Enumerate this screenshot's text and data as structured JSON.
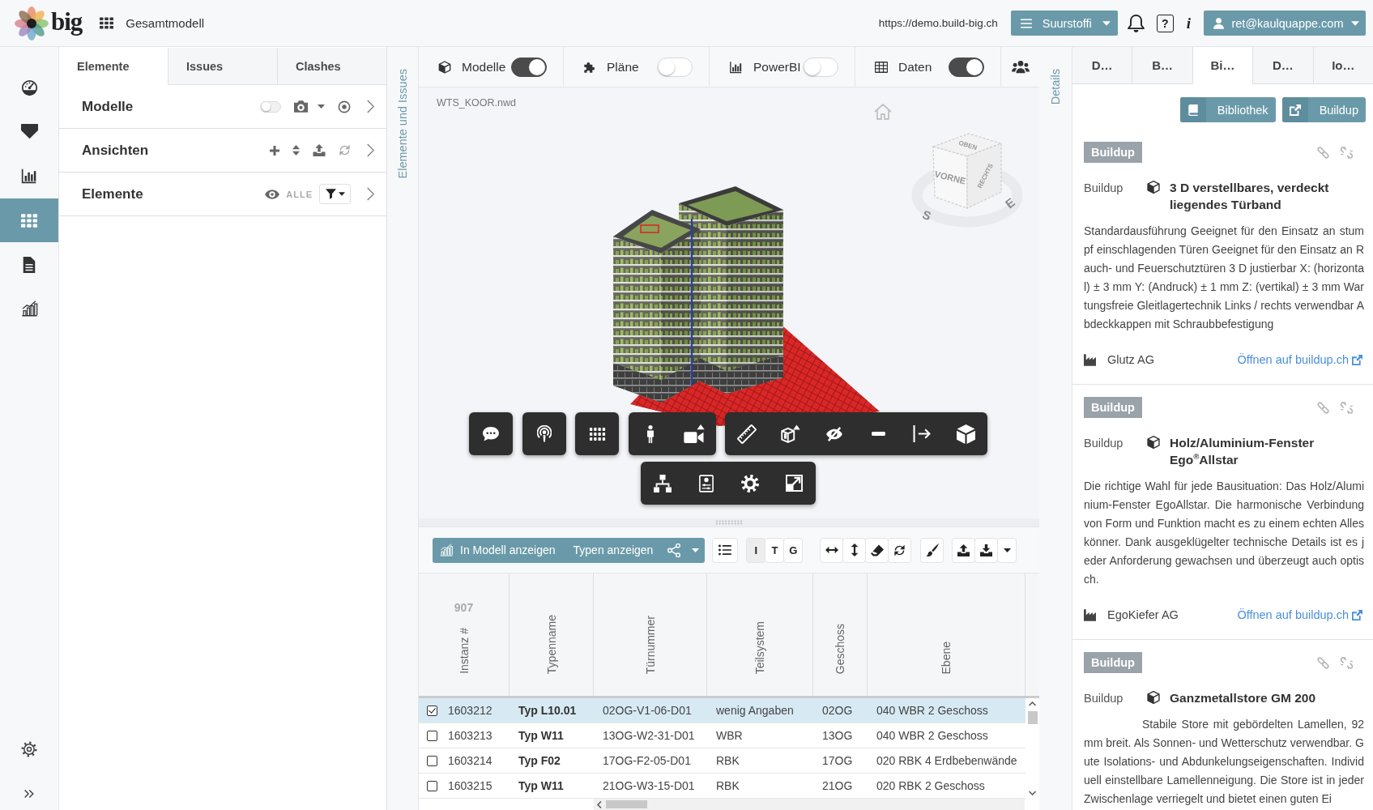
{
  "top_bar": {
    "logo": "big",
    "project": "Gesamtmodell",
    "url": "https://demo.build-big.ch",
    "project_menu": "Suurstoffi",
    "help": "?",
    "info": "i",
    "user_menu": "ret@kaulquappe.com"
  },
  "sidebar": {
    "items": [
      {
        "selected": false
      },
      {
        "selected": false
      },
      {
        "selected": false
      },
      {
        "selected": true
      },
      {
        "selected": false
      },
      {
        "selected": false
      }
    ]
  },
  "left_panel": {
    "tabs": [
      {
        "label": "Elemente",
        "selected": true
      },
      {
        "label": "Issues",
        "selected": false
      },
      {
        "label": "Clashes",
        "selected": false
      }
    ],
    "sections": [
      {
        "kind": "models",
        "title": "Modelle",
        "on": false
      },
      {
        "kind": "views",
        "title": "Ansichten"
      },
      {
        "kind": "elements",
        "title": "Elemente",
        "filter_label": "ALLE"
      }
    ]
  },
  "left_side_tab": {
    "label": "Elemente und Issues"
  },
  "layers": [
    {
      "label": "Modelle",
      "on": true
    },
    {
      "label": "Pläne",
      "on": false
    },
    {
      "label": "PowerBI",
      "on": false
    },
    {
      "label": "Daten",
      "on": true
    }
  ],
  "viewer": {
    "file_name": "WTS_KOOR.nwd",
    "view_cube": {
      "top": "OBEN",
      "front": "VORNE",
      "right": "RECHTS",
      "compass": [
        "S",
        "E"
      ]
    }
  },
  "data_toolbar": {
    "show_in_model": "In Modell anzeigen",
    "show_types": "Typen anzeigen",
    "modes": [
      {
        "label": "I",
        "selected": true
      },
      {
        "label": "T",
        "selected": false
      },
      {
        "label": "G",
        "selected": false
      }
    ]
  },
  "table": {
    "count": "907",
    "columns": [
      "Instanz #",
      "Typenname",
      "Türnummer",
      "Teilsystem",
      "Geschoss",
      "Ebene"
    ],
    "rows": [
      {
        "selected": true,
        "checked": true,
        "cells": [
          "1603212",
          "Typ L10.01",
          "02OG-V1-06-D01",
          "wenig Angaben",
          "02OG",
          "040 WBR 2 Geschoss"
        ]
      },
      {
        "selected": false,
        "checked": false,
        "cells": [
          "1603213",
          "Typ W11",
          "13OG-W2-31-D01",
          "WBR",
          "13OG",
          "040 WBR 2 Geschoss"
        ]
      },
      {
        "selected": false,
        "checked": false,
        "cells": [
          "1603214",
          "Typ F02",
          "17OG-F2-05-D01",
          "RBK",
          "17OG",
          "020 RBK 4 Erdbebenwände"
        ]
      },
      {
        "selected": false,
        "checked": false,
        "cells": [
          "1603215",
          "Typ W11",
          "21OG-W3-15-D01",
          "RBK",
          "21OG",
          "020 RBK 2 Geschoss"
        ]
      }
    ]
  },
  "right_side_tab": {
    "label": "Details"
  },
  "right_panel": {
    "tabs": [
      {
        "label": "D…",
        "selected": false
      },
      {
        "label": "B…",
        "selected": false
      },
      {
        "label": "Bi…",
        "selected": true
      },
      {
        "label": "D…",
        "selected": false
      },
      {
        "label": "Io…",
        "selected": false
      }
    ],
    "buttons": [
      "Bibliothek",
      "Buildup"
    ],
    "cards": [
      {
        "badge": "Buildup",
        "source": "Buildup",
        "title": "3 D verstellbares, verdeckt liegendes Türband",
        "description": "Standardausführung Geeignet für den Einsatz an stumpf einschlagenden Türen Geeignet für den Einsatz an Rauch- und Feuerschutztüren 3 D justierbar X: (horizontal) ± 3 mm Y: (Andruck) ± 1 mm Z: (vertikal) ± 3 mm Wartungsfreie Gleitlagertechnik Links / rechts verwendbar Abdeckkappen mit Schraubbefestigung",
        "manufacturer": "Glutz AG",
        "link": "Öffnen auf buildup.ch"
      },
      {
        "badge": "Buildup",
        "source": "Buildup",
        "title": "Holz/Aluminium-Fenster Ego$^{®}$Allstar",
        "description": "Die richtige Wahl für jede Bausituation: Das Holz/Aluminium-Fenster EgoAllstar. Die harmonische Verbindung von Form und Funktion macht es zu einem echten Alleskönner. Dank ausgeklügelter technische Details ist es jeder Anforderung gewachsen und überzeugt auch optisch.",
        "manufacturer": "EgoKiefer AG",
        "link": "Öffnen auf buildup.ch"
      },
      {
        "badge": "Buildup",
        "source": "Buildup",
        "title": "Ganzmetallstore GM 200",
        "description": "Stabile Store mit gebördelten Lamellen, 92 mm breit. Als Sonnen- und Wetterschutz verwendbar. Gute Isolations- und Abdunkelungseigenschaften. Individuell einstellbare Lamellenneigung. Die Store ist in jeder Zwischenlage verriegelt und bietet einen guten Ei"
      }
    ]
  }
}
